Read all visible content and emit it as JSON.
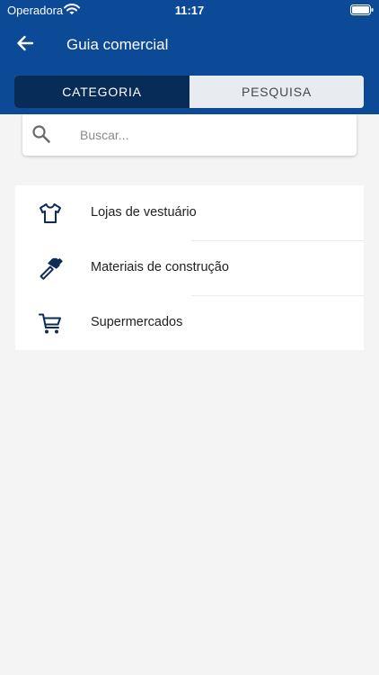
{
  "status_bar": {
    "carrier": "Operadora",
    "time": "11:17"
  },
  "nav": {
    "title": "Guia comercial",
    "back_icon": "arrow-left-icon"
  },
  "tabs": [
    {
      "label": "CATEGORIA",
      "active": true
    },
    {
      "label": "PESQUISA",
      "active": false
    }
  ],
  "search": {
    "placeholder": "Buscar...",
    "value": "",
    "icon": "search-icon"
  },
  "categories": [
    {
      "label": "Lojas de vestuário",
      "icon": "tshirt-icon"
    },
    {
      "label": "Materiais de construção",
      "icon": "hammer-icon"
    },
    {
      "label": "Supermercados",
      "icon": "shopping-cart-icon"
    }
  ],
  "colors": {
    "header": "#0c4a98",
    "tab_active": "#082c58",
    "tab_inactive": "#e8ebf0",
    "icon": "#0c2d57",
    "background": "#f4f4f4"
  }
}
